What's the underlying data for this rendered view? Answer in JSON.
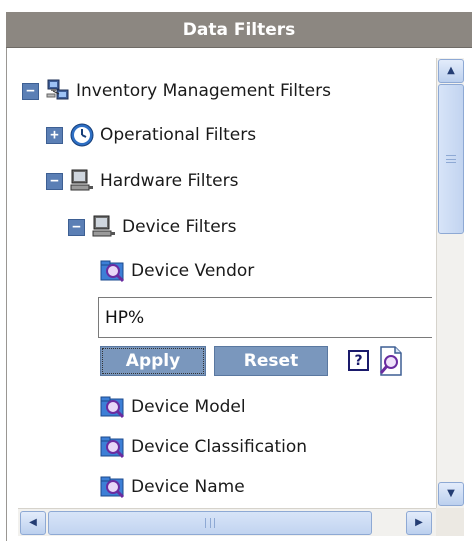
{
  "panel": {
    "title": "Data Filters"
  },
  "tree": {
    "root": {
      "label": "Inventory Management Filters",
      "toggle": "−",
      "icon": "network-computers-icon"
    },
    "operational": {
      "label": "Operational Filters",
      "toggle": "+",
      "icon": "clock-icon"
    },
    "hardware": {
      "label": "Hardware Filters",
      "toggle": "−",
      "icon": "computer-icon"
    },
    "device": {
      "label": "Device Filters",
      "toggle": "−",
      "icon": "computer-icon"
    },
    "vendor": {
      "label": "Device Vendor",
      "icon": "search-folder-icon"
    },
    "model": {
      "label": "Device Model",
      "icon": "search-folder-icon"
    },
    "classification": {
      "label": "Device Classification",
      "icon": "search-folder-icon"
    },
    "name": {
      "label": "Device Name",
      "icon": "search-folder-icon"
    }
  },
  "vendor_filter": {
    "value": "HP%",
    "apply_label": "Apply",
    "reset_label": "Reset",
    "help_label": "?"
  },
  "colors": {
    "header_bg": "#8c8781",
    "button_bg": "#7a97bd",
    "toggle_bg": "#5b7fb5"
  }
}
